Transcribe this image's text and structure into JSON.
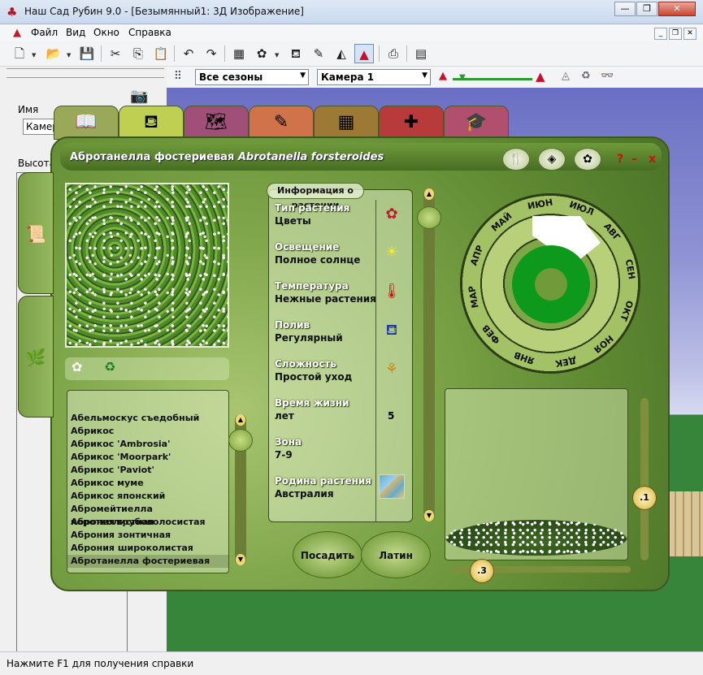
{
  "window": {
    "title": "Наш Сад Рубин 9.0 - [Безымянный1: 3Д Изображение]",
    "min": "—",
    "max": "❐",
    "close": "✕"
  },
  "menu": {
    "items": [
      "Файл",
      "Вид",
      "Окно",
      "Справка"
    ]
  },
  "toolbar": {
    "icons": [
      "new-icon",
      "open-icon",
      "save-icon",
      "cut-icon",
      "copy-icon",
      "paste-icon",
      "undo-icon",
      "redo-icon",
      "terrain-icon",
      "flower-icon",
      "watering-can-icon",
      "notes-icon",
      "landscape-icon",
      "3d-view-icon",
      "print-icon",
      "calculator-icon"
    ]
  },
  "toolbar2": {
    "season_value": "Все сезоны",
    "camera_value": "Камера 1",
    "slider_level": 0.15
  },
  "left_panel": {
    "name_label": "Имя",
    "name_value": "Камера",
    "height_label": "Высота"
  },
  "dialog": {
    "title_common": "Абротанелла фостериевая",
    "title_latin": "Abrotanella forsteroides",
    "info_heading": "Информация о растении",
    "info": [
      {
        "label": "Тип растения",
        "value": "Цветы",
        "icon": "flower-icon"
      },
      {
        "label": "Освещение",
        "value": "Полное солнце",
        "icon": "sun-icon"
      },
      {
        "label": "Температура",
        "value": "Нежные растения",
        "icon": "thermometer-icon"
      },
      {
        "label": "Полив",
        "value": "Регулярный",
        "icon": "watering-can-icon"
      },
      {
        "label": "Сложность",
        "value": "Простой уход",
        "icon": "seedling-icon"
      },
      {
        "label": "Время жизни",
        "value": "лет",
        "icon": ""
      },
      {
        "label": "Зона",
        "value": "7-9",
        "icon": ""
      },
      {
        "label": "Родина растения",
        "value": "Австралия",
        "icon": "world-map-icon"
      }
    ],
    "lifespan_years": "5",
    "plant_list": [
      "Абельмоскус съедобный",
      "Абрикос",
      "Абрикос 'Ambrosia'",
      "Абрикос 'Moorpark'",
      "Абрикос 'Paviot'",
      "Абрикос муме",
      "Абрикос японский",
      "Абромейтиелла коротколистная",
      "Аброния грубоволосистая",
      "Аброния зонтичная",
      "Аброния широколистая",
      "Абротанелла фостериевая"
    ],
    "selected_index": 11,
    "buttons": {
      "plant": "Посадить",
      "latin": "Латин"
    },
    "header_icons": {
      "help": "?",
      "minimize": "–",
      "close": "x"
    },
    "calendar_months": [
      "ИЮН",
      "ИЮЛ",
      "АВГ",
      "СЕН",
      "ОКТ",
      "НОЯ",
      "ДЕК",
      "ЯНВ",
      "ФЕВ",
      "МАР",
      "АПР",
      "МАЙ"
    ],
    "zoom_v": ".1",
    "zoom_h": ".3"
  },
  "status": {
    "text": "Нажмите F1 для получения справки"
  }
}
